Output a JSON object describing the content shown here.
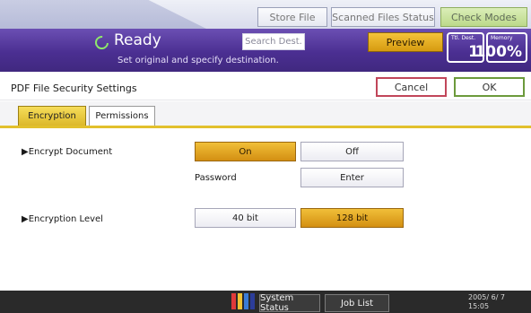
{
  "top_buttons": {
    "store_file": "Store File",
    "scanned_files_status": "Scanned Files Status",
    "check_modes": "Check Modes"
  },
  "status": {
    "ready": "Ready",
    "subtext": "Set original and specify destination.",
    "search_dest": "Search Dest.",
    "preview": "Preview",
    "ttl_dest_label": "Ttl. Dest.",
    "ttl_dest_value": "1",
    "memory_label": "Memory",
    "memory_value": "100%"
  },
  "dialog": {
    "title": "PDF File Security Settings",
    "cancel": "Cancel",
    "ok": "OK"
  },
  "tabs": [
    {
      "label": "Encryption",
      "active": true
    },
    {
      "label": "Permissions",
      "active": false
    }
  ],
  "settings": {
    "encrypt_document": {
      "label": "▶Encrypt Document",
      "on": "On",
      "off": "Off",
      "selected": "On"
    },
    "password": {
      "label": "Password",
      "button": "Enter"
    },
    "encryption_level": {
      "label": "▶Encryption Level",
      "option_40": "40 bit",
      "option_128": "128 bit",
      "selected": "128 bit"
    }
  },
  "bottom": {
    "system_status": "System Status",
    "job_list": "Job List",
    "date": "2005/ 6/ 7",
    "time": "15:05"
  },
  "colors": {
    "purple_band": "#4b2f92",
    "selected_orange": "#e3a42a",
    "tab_yellow": "#e2c02c"
  }
}
